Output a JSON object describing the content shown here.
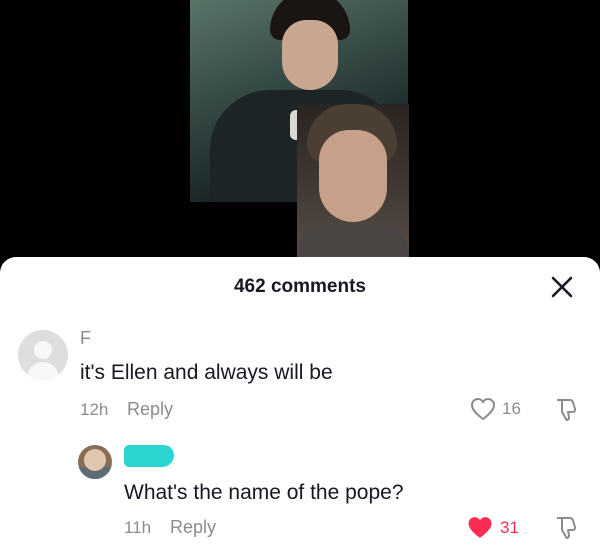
{
  "header": {
    "comments_count_label": "462 comments"
  },
  "comments": [
    {
      "username": "F",
      "text": "it's Ellen and always will be",
      "time": "12h",
      "reply_label": "Reply",
      "likes": "16",
      "liked": false
    },
    {
      "username": "",
      "text": "What's the name of the pope?",
      "time": "11h",
      "reply_label": "Reply",
      "likes": "31",
      "liked": true
    }
  ],
  "icons": {
    "close": "close-icon",
    "heart_outline": "heart-outline-icon",
    "heart_filled": "heart-filled-icon",
    "dislike": "thumbs-down-icon"
  },
  "colors": {
    "accent_like": "#fe2c55",
    "muted_text": "#8a8b91",
    "primary_text": "#161823",
    "redaction": "#2ad6cf"
  }
}
